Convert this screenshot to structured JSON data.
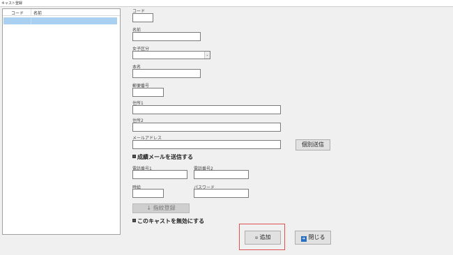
{
  "window": {
    "title": "キャスト登録"
  },
  "list": {
    "columns": [
      "コード",
      "名前"
    ],
    "rows": [
      {
        "code": "",
        "name": ""
      }
    ]
  },
  "form": {
    "code_label": "コード",
    "name_label": "名前",
    "category_label": "女子区分",
    "category_value": "",
    "realname_label": "本名",
    "postal_label": "郵便番号",
    "address1_label": "住所1",
    "address2_label": "住所2",
    "email_label": "メールアドレス",
    "individual_send_label": "個別送信",
    "send_mail_checkbox_label": "成績メールを送信する",
    "phone1_label": "電話番号1",
    "phone2_label": "電話番号2",
    "hourly_label": "時給",
    "password_label": "パスワード",
    "fingerprint_label": "指紋登録",
    "disable_checkbox_label": "このキャストを無効にする",
    "add_label": "追加",
    "close_label": "閉じる"
  },
  "icons": {
    "add": "plus-icon",
    "close": "exit-icon",
    "fingerprint": "fingerprint-icon",
    "combo_arrow": "chevron-down-icon"
  }
}
